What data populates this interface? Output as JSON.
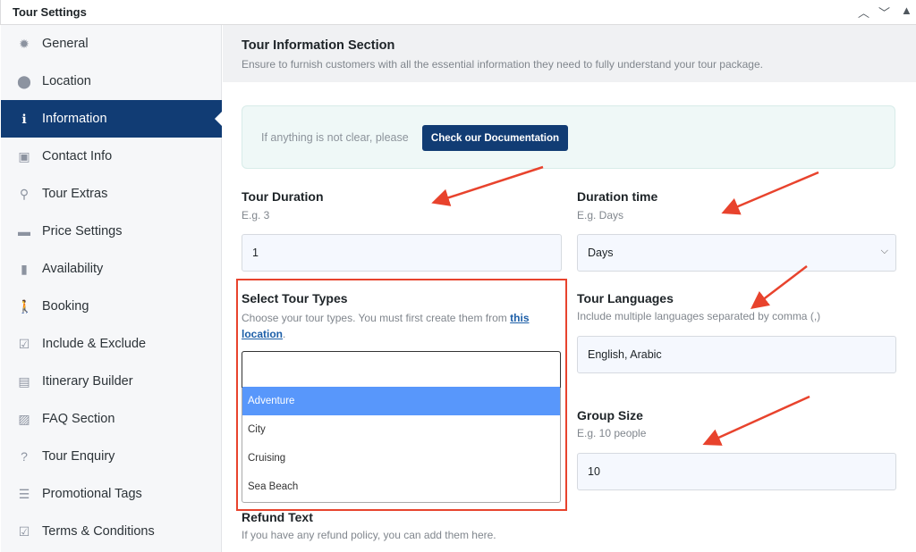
{
  "header": {
    "title": "Tour Settings"
  },
  "sidebar": {
    "items": [
      {
        "label": "General",
        "icon": "gear-icon",
        "glyph": "✹"
      },
      {
        "label": "Location",
        "icon": "map-pin-icon",
        "glyph": "⬤"
      },
      {
        "label": "Information",
        "icon": "info-icon",
        "glyph": "ℹ",
        "active": true
      },
      {
        "label": "Contact Info",
        "icon": "contact-card-icon",
        "glyph": "▣"
      },
      {
        "label": "Tour Extras",
        "icon": "route-icon",
        "glyph": "⚲"
      },
      {
        "label": "Price Settings",
        "icon": "credit-card-icon",
        "glyph": "▬"
      },
      {
        "label": "Availability",
        "icon": "clipboard-icon",
        "glyph": "▮"
      },
      {
        "label": "Booking",
        "icon": "walking-icon",
        "glyph": "🚶"
      },
      {
        "label": "Include & Exclude",
        "icon": "check-square-icon",
        "glyph": "☑"
      },
      {
        "label": "Itinerary Builder",
        "icon": "clipboard-list-icon",
        "glyph": "▤"
      },
      {
        "label": "FAQ Section",
        "icon": "faq-icon",
        "glyph": "▨"
      },
      {
        "label": "Tour Enquiry",
        "icon": "question-circle-icon",
        "glyph": "?"
      },
      {
        "label": "Promotional Tags",
        "icon": "list-icon",
        "glyph": "☰"
      },
      {
        "label": "Terms & Conditions",
        "icon": "checkbox-icon",
        "glyph": "☑"
      }
    ]
  },
  "section": {
    "title": "Tour Information Section",
    "description": "Ensure to furnish customers with all the essential information they need to fully understand your tour package."
  },
  "notice": {
    "text": "If anything is not clear, please",
    "button": "Check our Documentation"
  },
  "fields": {
    "duration": {
      "label": "Tour Duration",
      "hint": "E.g. 3",
      "value": "1"
    },
    "duration_time": {
      "label": "Duration time",
      "hint": "E.g. Days",
      "value": "Days"
    },
    "tour_types": {
      "label": "Select Tour Types",
      "hint": "Choose your tour types. You must first create them from",
      "link": "this location",
      "hint_end": ".",
      "value": "",
      "options": [
        "Adventure",
        "City",
        "Cruising",
        "Sea Beach"
      ],
      "highlighted": "Adventure"
    },
    "languages": {
      "label": "Tour Languages",
      "hint": "Include multiple languages separated by comma (,)",
      "value": "English, Arabic"
    },
    "group_size": {
      "label": "Group Size",
      "hint": "E.g. 10 people",
      "value": "10"
    },
    "refund": {
      "label": "Refund Text",
      "hint": "If you have any refund policy, you can add them here."
    }
  },
  "colors": {
    "accent": "#113c74",
    "highlight": "#5897fb",
    "annotation": "#e8432d"
  }
}
